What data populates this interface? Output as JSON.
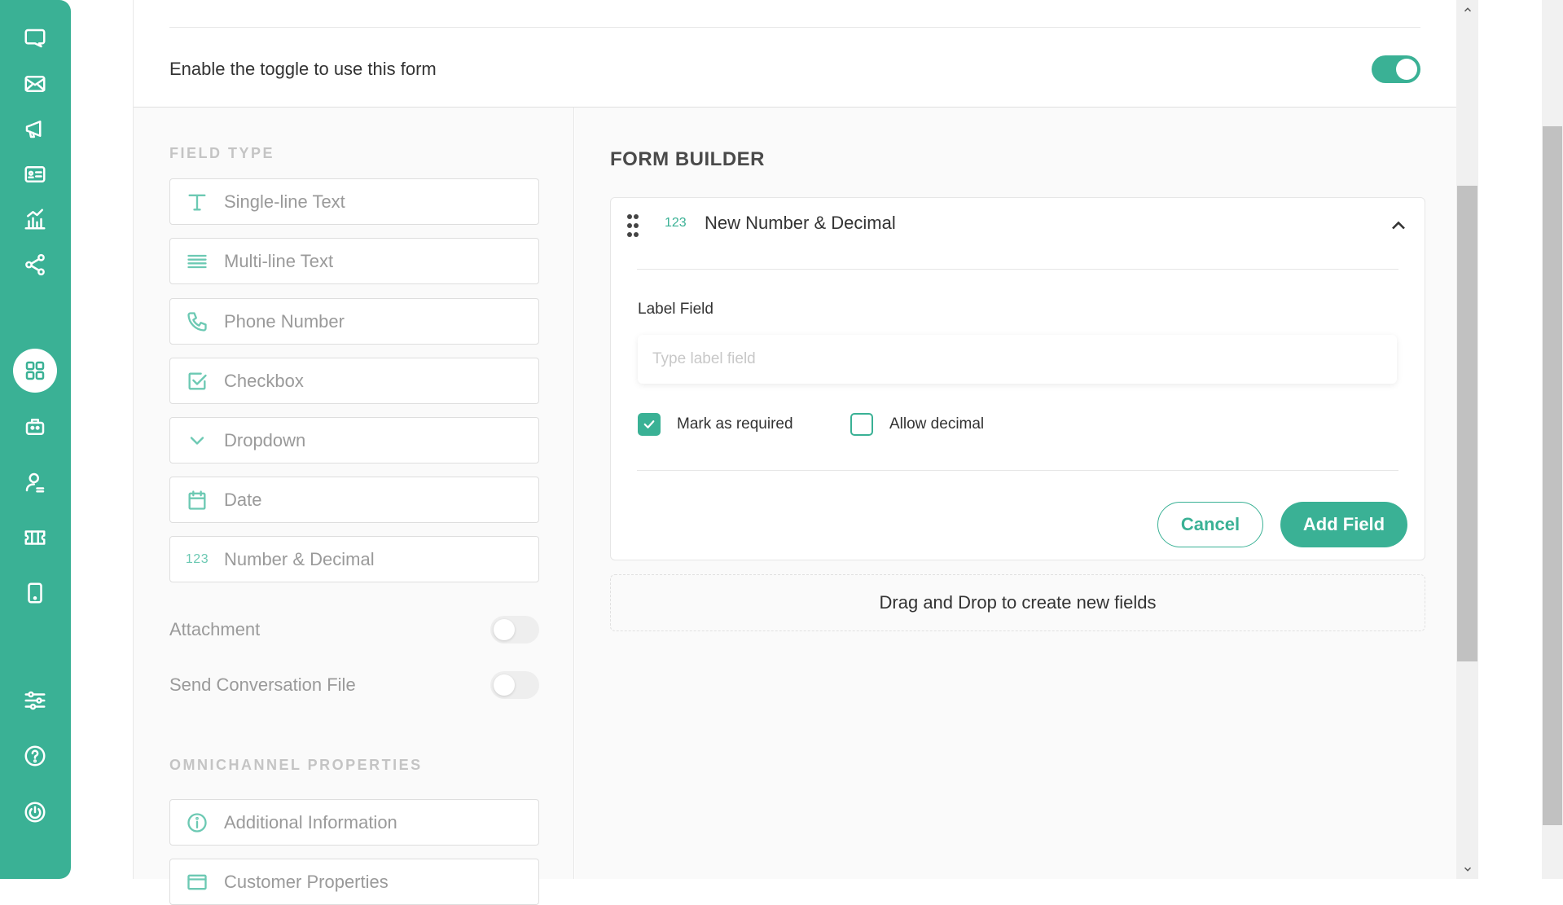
{
  "sidebar": {
    "items": [
      {
        "name": "chat-icon"
      },
      {
        "name": "mail-icon"
      },
      {
        "name": "megaphone-icon"
      },
      {
        "name": "contact-card-icon"
      },
      {
        "name": "analytics-icon"
      },
      {
        "name": "share-nodes-icon"
      },
      {
        "name": "apps-grid-icon"
      },
      {
        "name": "bot-icon"
      },
      {
        "name": "agent-icon"
      },
      {
        "name": "ticket-icon"
      },
      {
        "name": "mobile-device-icon"
      },
      {
        "name": "settings-sliders-icon"
      },
      {
        "name": "help-icon"
      },
      {
        "name": "power-icon"
      }
    ],
    "active": "apps-grid-icon",
    "color": "#3ab195"
  },
  "header": {
    "enable_label": "Enable the toggle to use this form",
    "enable_toggle_on": true
  },
  "field_types": {
    "title": "FIELD TYPE",
    "items": [
      {
        "label": "Single-line Text",
        "icon": "text-t-icon"
      },
      {
        "label": "Multi-line Text",
        "icon": "lines-icon"
      },
      {
        "label": "Phone Number",
        "icon": "phone-icon"
      },
      {
        "label": "Checkbox",
        "icon": "checkbox-icon"
      },
      {
        "label": "Dropdown",
        "icon": "chevron-down-icon"
      },
      {
        "label": "Date",
        "icon": "calendar-icon"
      },
      {
        "label": "Number & Decimal",
        "icon": "number-icon",
        "icon_text": "123"
      }
    ],
    "switches": [
      {
        "label": "Attachment",
        "on": false
      },
      {
        "label": "Send Conversation File",
        "on": false
      }
    ]
  },
  "omnichannel": {
    "title": "OMNICHANNEL PROPERTIES",
    "items": [
      {
        "label": "Additional Information",
        "icon": "info-icon"
      },
      {
        "label": "Customer Properties",
        "icon": "card-icon"
      }
    ]
  },
  "form_builder": {
    "title": "FORM BUILDER",
    "card": {
      "icon_text": "123",
      "title": "New Number & Decimal",
      "label_field_title": "Label Field",
      "label_placeholder": "Type label field",
      "label_value": "",
      "mark_required": {
        "label": "Mark as required",
        "checked": true
      },
      "allow_decimal": {
        "label": "Allow decimal",
        "checked": false
      },
      "cancel_label": "Cancel",
      "add_label": "Add Field"
    },
    "dropzone_text": "Drag and Drop to create new fields"
  }
}
